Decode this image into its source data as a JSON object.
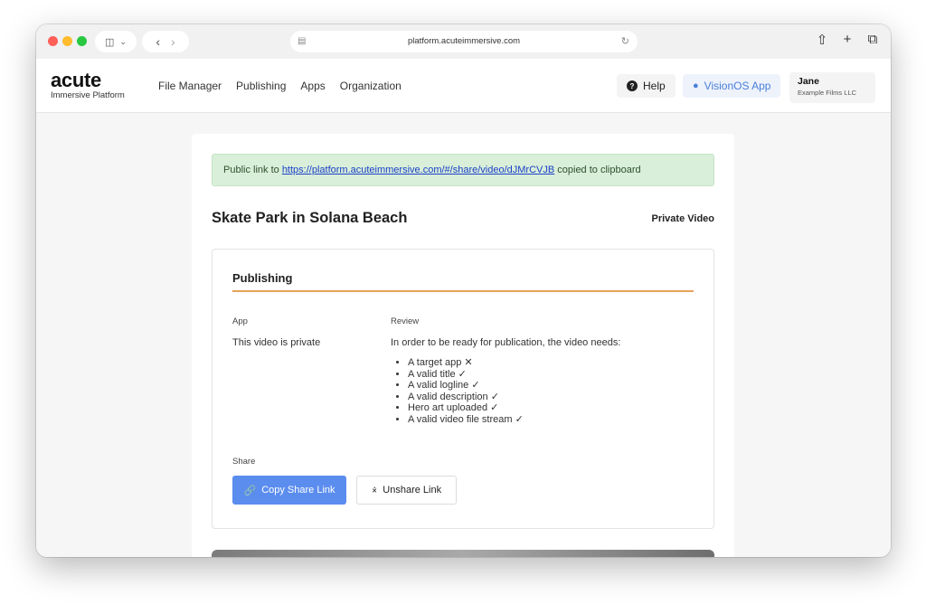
{
  "browser": {
    "url": "platform.acuteimmersive.com",
    "icons": [
      "sidebar-icon",
      "chevron-down-icon",
      "back-icon",
      "forward-icon",
      "reload-icon",
      "share-icon",
      "new-tab-icon",
      "tabs-icon"
    ]
  },
  "header": {
    "brand": "acute",
    "brand_sub": "Immersive Platform",
    "nav": [
      "File Manager",
      "Publishing",
      "Apps",
      "Organization"
    ],
    "help_label": "Help",
    "vision_label": "VisionOS App",
    "user_name": "Jane",
    "user_org": "Example Films LLC"
  },
  "alert": {
    "prefix": "Public link to ",
    "link": "https://platform.acuteimmersive.com/#/share/video/dJMrCVJB",
    "suffix": " copied to clipboard"
  },
  "video": {
    "title": "Skate Park in Solana Beach",
    "status": "Private Video"
  },
  "publishing": {
    "title": "Publishing",
    "app_head": "App",
    "app_text": "This video is private",
    "review_head": "Review",
    "review_text": "In order to be ready for publication, the video needs:",
    "checklist": [
      {
        "label": "A target app",
        "mark": "✕"
      },
      {
        "label": "A valid title",
        "mark": "✓"
      },
      {
        "label": "A valid logline",
        "mark": "✓"
      },
      {
        "label": "A valid description",
        "mark": "✓"
      },
      {
        "label": "Hero art uploaded",
        "mark": "✓"
      },
      {
        "label": "A valid video file stream",
        "mark": "✓"
      }
    ],
    "share_head": "Share",
    "copy_label": "Copy Share Link",
    "unshare_label": "Unshare Link"
  },
  "colors": {
    "accent_blue": "#5b8def",
    "alert_green": "#d9efd9",
    "divider_orange": "#e7a25a"
  }
}
